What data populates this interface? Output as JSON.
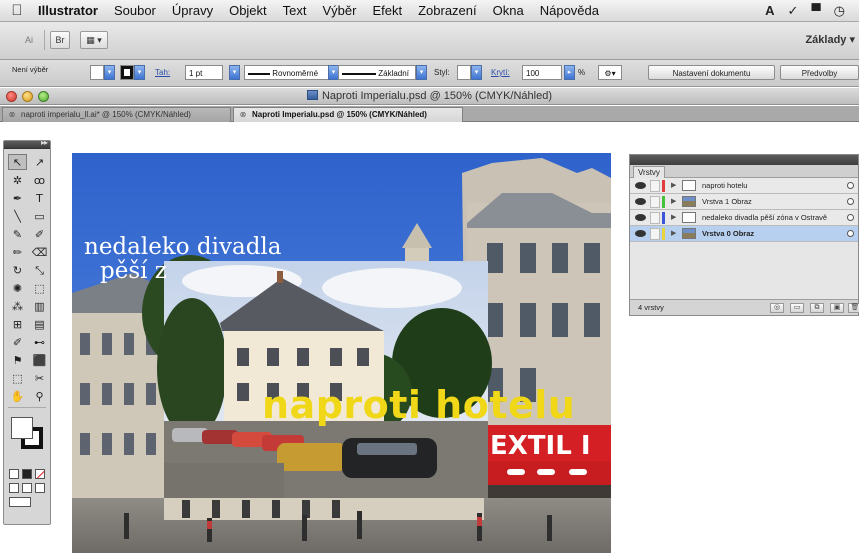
{
  "menubar": {
    "apple_icon": "apple-logo",
    "app_name": "Illustrator",
    "items": [
      "Soubor",
      "Úpravy",
      "Objekt",
      "Text",
      "Výběr",
      "Efekt",
      "Zobrazení",
      "Okna",
      "Nápověda"
    ],
    "right_icons": [
      "adobe-drive-icon",
      "check-icon",
      "display-icon",
      "time-machine-icon"
    ]
  },
  "appbar": {
    "buttons": [
      "Ai",
      "Br",
      "layout-arrange"
    ],
    "workspace_label": "Základy ▾"
  },
  "control_bar": {
    "selection_label": "Není výběr",
    "stroke_label": "Tah:",
    "stroke_weight": "1 pt",
    "profile_label": "Rovnoměrné",
    "brush_label": "Základní",
    "style_label": "Styl:",
    "opacity_label": "Krytí:",
    "opacity_value": "100",
    "percent": "%",
    "doc_setup_button": "Nastavení dokumentu",
    "preferences_button": "Předvolby"
  },
  "window": {
    "title": "Naproti Imperialu.psd @ 150% (CMYK/Náhled)"
  },
  "tabs": [
    {
      "label": "naproti imperialu_ll.ai* @ 150% (CMYK/Náhled)",
      "active": false
    },
    {
      "label": "Naproti Imperialu.psd @ 150% (CMYK/Náhled)",
      "active": true
    }
  ],
  "artwork": {
    "line1": "nedaleko divadla",
    "line2": "pěší z",
    "hotel_text": "naproti hotelu",
    "sign_text": "EXTIL I"
  },
  "tools": {
    "items": [
      "selection",
      "direct-selection",
      "magic-wand",
      "lasso",
      "pen",
      "type",
      "line",
      "rectangle",
      "paintbrush",
      "pencil",
      "blob-brush",
      "eraser",
      "rotate",
      "scale",
      "warp",
      "free-transform",
      "symbol-sprayer",
      "graph",
      "mesh",
      "gradient",
      "eyedropper",
      "blend",
      "live-paint",
      "live-paint-selection",
      "artboard",
      "slice",
      "hand",
      "zoom"
    ],
    "glyphs": [
      "↖",
      "↗",
      "✲",
      "ꝏ",
      "✒",
      "T",
      "╲",
      "▭",
      "✎",
      "✐",
      "✏",
      "⌫",
      "↻",
      "⤡",
      "✺",
      "⬚",
      "⁂",
      "▥",
      "⊞",
      "▤",
      "✐",
      "⊷",
      "⚑",
      "⬛",
      "⬚",
      "✂",
      "✋",
      "⚲"
    ]
  },
  "layers_panel": {
    "tab": "Vrstvy",
    "rows": [
      {
        "name": "naproti hotelu",
        "color": "#e23b3b",
        "thumb": "text",
        "selected": false
      },
      {
        "name": "Vrstva 1 Obraz",
        "color": "#45c23a",
        "thumb": "img",
        "selected": false
      },
      {
        "name": "nedaleko divadla  pěší zóna v Ostravě",
        "color": "#3a55d8",
        "thumb": "text",
        "selected": false
      },
      {
        "name": "Vrstva 0 Obraz",
        "color": "#e6d43a",
        "thumb": "img",
        "selected": true
      }
    ],
    "count": "4 vrstvy"
  }
}
